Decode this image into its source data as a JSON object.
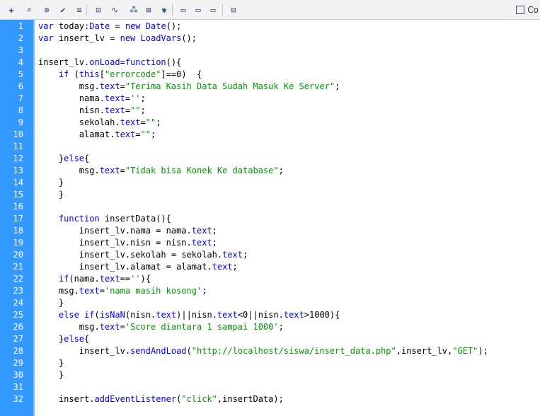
{
  "toolbar": {
    "buttons": [
      {
        "name": "add-statement-icon",
        "glyph": "✚"
      },
      {
        "name": "find-icon",
        "glyph": "⌕"
      },
      {
        "name": "target-icon",
        "glyph": "⊕"
      },
      {
        "name": "check-syntax-icon",
        "glyph": "✔"
      },
      {
        "name": "auto-format-icon",
        "glyph": "≡"
      },
      {
        "name": "code-hint-icon",
        "glyph": "⊡"
      },
      {
        "name": "debug-options-icon",
        "glyph": "∿"
      },
      {
        "name": "collapse-between-braces-icon",
        "glyph": "⁂"
      },
      {
        "name": "collapse-selection-icon",
        "glyph": "⊞"
      },
      {
        "name": "expand-all-icon",
        "glyph": "✱"
      },
      {
        "name": "apply-block-comment-icon",
        "glyph": "▭"
      },
      {
        "name": "apply-line-comment-icon",
        "glyph": "▭"
      },
      {
        "name": "remove-comment-icon",
        "glyph": "▭"
      },
      {
        "name": "show-hide-toolbox-icon",
        "glyph": "⊟"
      }
    ],
    "code_snippets_label": "Co",
    "code_snippets_icon": "code-snippets-icon"
  },
  "colors": {
    "keyword": "#0000ff",
    "string": "#009900",
    "gutter_bg": "#3399ff",
    "line_number": "#ffffff"
  },
  "code_lines": [
    {
      "n": "1",
      "tokens": [
        {
          "t": "var",
          "k": "kw"
        },
        {
          "t": " today:"
        },
        {
          "t": "Date",
          "k": "kw"
        },
        {
          "t": " = "
        },
        {
          "t": "new",
          "k": "kw"
        },
        {
          "t": " "
        },
        {
          "t": "Date",
          "k": "kw"
        },
        {
          "t": "();"
        }
      ]
    },
    {
      "n": "2",
      "tokens": [
        {
          "t": "var",
          "k": "kw"
        },
        {
          "t": " insert_lv = "
        },
        {
          "t": "new",
          "k": "kw"
        },
        {
          "t": " "
        },
        {
          "t": "LoadVars",
          "k": "kw"
        },
        {
          "t": "();"
        }
      ]
    },
    {
      "n": "3",
      "tokens": []
    },
    {
      "n": "4",
      "tokens": [
        {
          "t": "insert_lv."
        },
        {
          "t": "onLoad",
          "k": "kw"
        },
        {
          "t": "="
        },
        {
          "t": "function",
          "k": "kw"
        },
        {
          "t": "(){"
        }
      ]
    },
    {
      "n": "5",
      "tokens": [
        {
          "t": "    "
        },
        {
          "t": "if",
          "k": "kw"
        },
        {
          "t": " ("
        },
        {
          "t": "this",
          "k": "kw"
        },
        {
          "t": "["
        },
        {
          "t": "\"errorcode\"",
          "k": "str"
        },
        {
          "t": "]==0)  {"
        }
      ]
    },
    {
      "n": "6",
      "tokens": [
        {
          "t": "        msg."
        },
        {
          "t": "text",
          "k": "kw"
        },
        {
          "t": "="
        },
        {
          "t": "\"Terima Kasih Data Sudah Masuk Ke Server\"",
          "k": "str"
        },
        {
          "t": ";"
        }
      ]
    },
    {
      "n": "7",
      "tokens": [
        {
          "t": "        nama."
        },
        {
          "t": "text",
          "k": "kw"
        },
        {
          "t": "="
        },
        {
          "t": "''",
          "k": "str"
        },
        {
          "t": ";"
        }
      ]
    },
    {
      "n": "8",
      "tokens": [
        {
          "t": "        nisn."
        },
        {
          "t": "text",
          "k": "kw"
        },
        {
          "t": "="
        },
        {
          "t": "\"\"",
          "k": "str"
        },
        {
          "t": ";"
        }
      ]
    },
    {
      "n": "9",
      "tokens": [
        {
          "t": "        sekolah."
        },
        {
          "t": "text",
          "k": "kw"
        },
        {
          "t": "="
        },
        {
          "t": "\"\"",
          "k": "str"
        },
        {
          "t": ";"
        }
      ]
    },
    {
      "n": "10",
      "tokens": [
        {
          "t": "        alamat."
        },
        {
          "t": "text",
          "k": "kw"
        },
        {
          "t": "="
        },
        {
          "t": "\"\"",
          "k": "str"
        },
        {
          "t": ";"
        }
      ]
    },
    {
      "n": "11",
      "tokens": []
    },
    {
      "n": "12",
      "tokens": [
        {
          "t": "    }"
        },
        {
          "t": "else",
          "k": "kw"
        },
        {
          "t": "{"
        }
      ]
    },
    {
      "n": "13",
      "tokens": [
        {
          "t": "        msg."
        },
        {
          "t": "text",
          "k": "kw"
        },
        {
          "t": "="
        },
        {
          "t": "\"Tidak bisa Konek Ke database\"",
          "k": "str"
        },
        {
          "t": ";"
        }
      ]
    },
    {
      "n": "14",
      "tokens": [
        {
          "t": "    }"
        }
      ]
    },
    {
      "n": "15",
      "tokens": [
        {
          "t": "    }"
        }
      ]
    },
    {
      "n": "16",
      "tokens": []
    },
    {
      "n": "17",
      "tokens": [
        {
          "t": "    "
        },
        {
          "t": "function",
          "k": "kw"
        },
        {
          "t": " insertData(){"
        }
      ]
    },
    {
      "n": "18",
      "tokens": [
        {
          "t": "        insert_lv.nama = nama."
        },
        {
          "t": "text",
          "k": "kw"
        },
        {
          "t": ";"
        }
      ]
    },
    {
      "n": "19",
      "tokens": [
        {
          "t": "        insert_lv.nisn = nisn."
        },
        {
          "t": "text",
          "k": "kw"
        },
        {
          "t": ";"
        }
      ]
    },
    {
      "n": "20",
      "tokens": [
        {
          "t": "        insert_lv.sekolah = sekolah."
        },
        {
          "t": "text",
          "k": "kw"
        },
        {
          "t": ";"
        }
      ]
    },
    {
      "n": "21",
      "tokens": [
        {
          "t": "        insert_lv.alamat = alamat."
        },
        {
          "t": "text",
          "k": "kw"
        },
        {
          "t": ";"
        }
      ]
    },
    {
      "n": "22",
      "tokens": [
        {
          "t": "    "
        },
        {
          "t": "if",
          "k": "kw"
        },
        {
          "t": "(nama."
        },
        {
          "t": "text",
          "k": "kw"
        },
        {
          "t": "=="
        },
        {
          "t": "''",
          "k": "str"
        },
        {
          "t": "){"
        }
      ]
    },
    {
      "n": "23",
      "tokens": [
        {
          "t": "    msg."
        },
        {
          "t": "text",
          "k": "kw"
        },
        {
          "t": "="
        },
        {
          "t": "'nama masih kosong'",
          "k": "str"
        },
        {
          "t": ";"
        }
      ]
    },
    {
      "n": "24",
      "tokens": [
        {
          "t": "    }"
        }
      ]
    },
    {
      "n": "25",
      "tokens": [
        {
          "t": "    "
        },
        {
          "t": "else",
          "k": "kw"
        },
        {
          "t": " "
        },
        {
          "t": "if",
          "k": "kw"
        },
        {
          "t": "("
        },
        {
          "t": "isNaN",
          "k": "kw"
        },
        {
          "t": "(nisn."
        },
        {
          "t": "text",
          "k": "kw"
        },
        {
          "t": ")||nisn."
        },
        {
          "t": "text",
          "k": "kw"
        },
        {
          "t": "<0||nisn."
        },
        {
          "t": "text",
          "k": "kw"
        },
        {
          "t": ">1000){"
        }
      ]
    },
    {
      "n": "26",
      "tokens": [
        {
          "t": "        msg."
        },
        {
          "t": "text",
          "k": "kw"
        },
        {
          "t": "="
        },
        {
          "t": "'Score diantara 1 sampai 1000'",
          "k": "str"
        },
        {
          "t": ";"
        }
      ]
    },
    {
      "n": "27",
      "tokens": [
        {
          "t": "    }"
        },
        {
          "t": "else",
          "k": "kw"
        },
        {
          "t": "{"
        }
      ]
    },
    {
      "n": "28",
      "tokens": [
        {
          "t": "        insert_lv."
        },
        {
          "t": "sendAndLoad",
          "k": "kw"
        },
        {
          "t": "("
        },
        {
          "t": "\"http://localhost/siswa/insert_data.php\"",
          "k": "str"
        },
        {
          "t": ",insert_lv,"
        },
        {
          "t": "\"GET\"",
          "k": "str"
        },
        {
          "t": ");"
        }
      ]
    },
    {
      "n": "29",
      "tokens": [
        {
          "t": "    }"
        }
      ]
    },
    {
      "n": "30",
      "tokens": [
        {
          "t": "    }"
        }
      ]
    },
    {
      "n": "31",
      "tokens": []
    },
    {
      "n": "32",
      "tokens": [
        {
          "t": "    insert."
        },
        {
          "t": "addEventListener",
          "k": "kw"
        },
        {
          "t": "("
        },
        {
          "t": "\"click\"",
          "k": "str"
        },
        {
          "t": ",insertData);"
        }
      ]
    }
  ]
}
